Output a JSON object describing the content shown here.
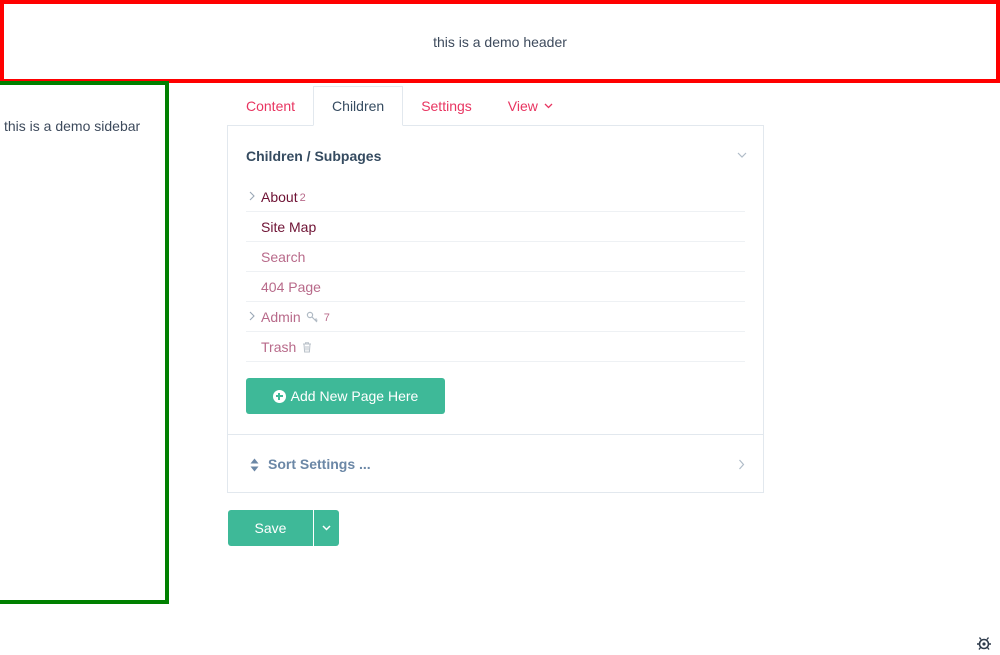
{
  "demo": {
    "header_text": "this is a demo header",
    "sidebar_text": "this is a demo sidebar"
  },
  "tabs": [
    {
      "label": "Content",
      "active": false
    },
    {
      "label": "Children",
      "active": true
    },
    {
      "label": "Settings",
      "active": false
    },
    {
      "label": "View",
      "active": false,
      "has_dropdown": true
    }
  ],
  "children_panel": {
    "title": "Children / Subpages",
    "pages": [
      {
        "label": "About",
        "count": "2",
        "expandable": true,
        "status": "published"
      },
      {
        "label": "Site Map",
        "status": "published"
      },
      {
        "label": "Search",
        "status": "hidden"
      },
      {
        "label": "404 Page",
        "status": "hidden"
      },
      {
        "label": "Admin",
        "count": "7",
        "icon": "key-icon",
        "expandable": true,
        "status": "hidden"
      },
      {
        "label": "Trash",
        "icon": "trash-icon",
        "status": "hidden"
      }
    ],
    "add_button_label": "Add New Page Here",
    "sort_label": "Sort Settings ..."
  },
  "footer": {
    "save_label": "Save"
  },
  "colors": {
    "accent": "#3eb998",
    "tab_link": "#e83561",
    "header_border": "#ff0000",
    "sidebar_border": "#008000"
  }
}
